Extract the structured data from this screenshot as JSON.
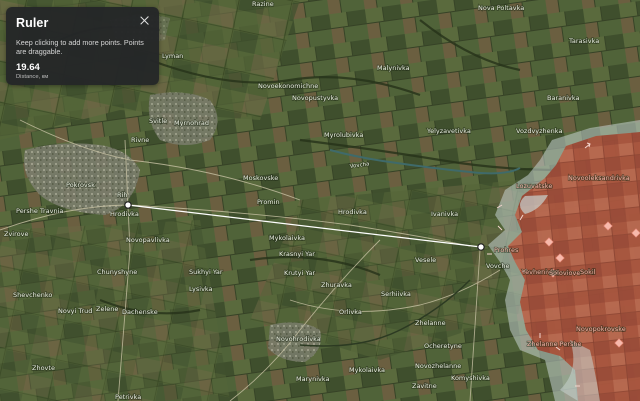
{
  "ruler": {
    "title": "Ruler",
    "hint": "Keep clicking to add more points. Points are draggable.",
    "distance_value": "19.64",
    "distance_unit": "Distance, км"
  },
  "map": {
    "towns": {
      "razine": "Razine",
      "nova_poltavka": "Nova Poltavka",
      "tarasivka": "Tarasivka",
      "lyman": "Lyman",
      "malynivka": "Malynivka",
      "novoekonomichne": "Novoekonomichne",
      "novopustyvka": "Novopustyvka",
      "baranivka": "Baranivka",
      "svitle": "Svitle",
      "myrnohrad": "Myrnohrad",
      "myrolubivka": "Myrolubivka",
      "yelyzavetivka": "Yelyzavetivka",
      "vozdvyzhenka": "Vozdvyzhenka",
      "rivne": "Rivne",
      "pokrovsk": "Pokrovsk",
      "lozuvatske": "Lozuvatske",
      "novooleksandrivka": "Novooleksandrivka",
      "rih": "Rih",
      "moskovske": "Moskovske",
      "pershe_travnia": "Pershe Travnia",
      "hrodivka": "Hrodivka",
      "promin": "Promin",
      "ivanivka": "Ivanivka",
      "zvirove": "Zvirove",
      "novopavlivka": "Novopavlivka",
      "mykolaivka": "Mykolaivka",
      "kraskyi_yar": "Krasnyi Yar",
      "prohres": "Prohres",
      "vesele": "Vesele",
      "yevhenivka": "Yevhenivka",
      "soloviove": "Soloviove",
      "sokil": "Sokil",
      "chunyshyne": "Chunyshyne",
      "sukhyi_yar": "Sukhyi Yar",
      "krutyi_yar": "Krutyi Yar",
      "shevchenko": "Shevchenko",
      "lysivka": "Lysivka",
      "zhuravka": "Zhuravka",
      "serhiivka": "Serhiivka",
      "novyi_trud": "Novyi Trud",
      "zelene": "Zelene",
      "dachenske": "Dachenske",
      "orlivka": "Orlivka",
      "zhelanne": "Zhelanne",
      "novopokrovske": "Novopokrovske",
      "novohrodivka": "Novohrodivka",
      "ocheretyne": "Ocheretyne",
      "zhelanne_pershe": "Zhelanne Pershe",
      "zhovte": "Zhovte",
      "marynivka": "Marynivka",
      "mykolaivka_2": "Mykolaivka",
      "novozhelanne": "Novozhelanne",
      "komyshivka": "Komyshivka",
      "zavitne": "Zavitne",
      "petrivka": "Petrivka",
      "voitsle": "Vovche",
      "lozuvatske_small": "Hrodivka"
    },
    "river": "Vovcha",
    "colors": {
      "occupied": "#b5563f",
      "frontline": "#cfd6d2",
      "ruler_line": "#ffffff"
    }
  }
}
